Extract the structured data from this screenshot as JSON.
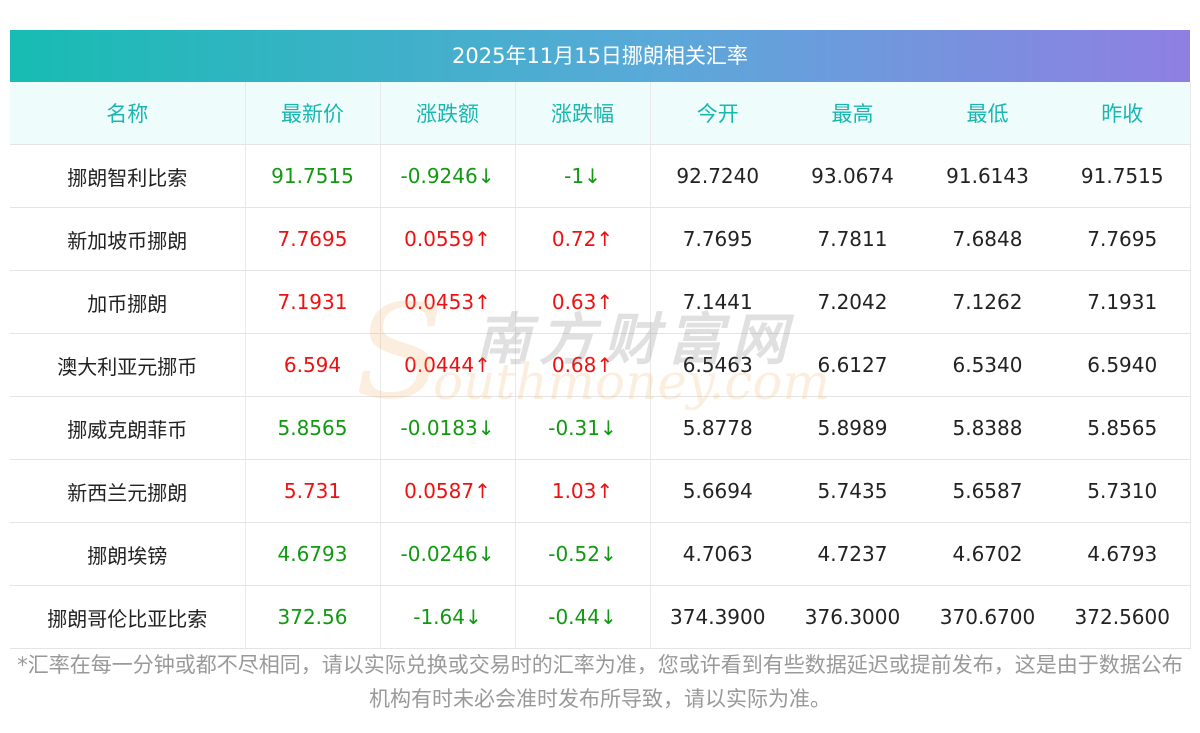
{
  "title": "2025年11月15日挪朗相关汇率",
  "columns": [
    "名称",
    "最新价",
    "涨跌额",
    "涨跌幅",
    "今开",
    "最高",
    "最低",
    "昨收"
  ],
  "rows": [
    {
      "name": "挪朗智利比索",
      "latest": "91.7515",
      "change": "-0.9246↓",
      "change_pct": "-1↓",
      "open": "92.7240",
      "high": "93.0674",
      "low": "91.6143",
      "prev_close": "91.7515",
      "trend": "down"
    },
    {
      "name": "新加坡币挪朗",
      "latest": "7.7695",
      "change": "0.0559↑",
      "change_pct": "0.72↑",
      "open": "7.7695",
      "high": "7.7811",
      "low": "7.6848",
      "prev_close": "7.7695",
      "trend": "up"
    },
    {
      "name": "加币挪朗",
      "latest": "7.1931",
      "change": "0.0453↑",
      "change_pct": "0.63↑",
      "open": "7.1441",
      "high": "7.2042",
      "low": "7.1262",
      "prev_close": "7.1931",
      "trend": "up"
    },
    {
      "name": "澳大利亚元挪币",
      "latest": "6.594",
      "change": "0.0444↑",
      "change_pct": "0.68↑",
      "open": "6.5463",
      "high": "6.6127",
      "low": "6.5340",
      "prev_close": "6.5940",
      "trend": "up"
    },
    {
      "name": "挪威克朗菲币",
      "latest": "5.8565",
      "change": "-0.0183↓",
      "change_pct": "-0.31↓",
      "open": "5.8778",
      "high": "5.8989",
      "low": "5.8388",
      "prev_close": "5.8565",
      "trend": "down"
    },
    {
      "name": "新西兰元挪朗",
      "latest": "5.731",
      "change": "0.0587↑",
      "change_pct": "1.03↑",
      "open": "5.6694",
      "high": "5.7435",
      "low": "5.6587",
      "prev_close": "5.7310",
      "trend": "up"
    },
    {
      "name": "挪朗埃镑",
      "latest": "4.6793",
      "change": "-0.0246↓",
      "change_pct": "-0.52↓",
      "open": "4.7063",
      "high": "4.7237",
      "low": "4.6702",
      "prev_close": "4.6793",
      "trend": "down"
    },
    {
      "name": "挪朗哥伦比亚比索",
      "latest": "372.56",
      "change": "-1.64↓",
      "change_pct": "-0.44↓",
      "open": "374.3900",
      "high": "376.3000",
      "low": "370.6700",
      "prev_close": "372.5600",
      "trend": "down"
    }
  ],
  "watermark": {
    "cn": "南方财富网",
    "en": "outhmoney.com",
    "s": "S"
  },
  "footnote": "*汇率在每一分钟或都不尽相同，请以实际兑换或交易时的汇率为准，您或许看到有些数据延迟或提前发布，这是由于数据公布机构有时未必会准时发布所导致，请以实际为准。",
  "colors": {
    "up": "#ee1111",
    "down": "#119911",
    "header_text": "#1ab7b0",
    "gradient_start": "#17bcb2",
    "gradient_end": "#8f7fe2"
  }
}
